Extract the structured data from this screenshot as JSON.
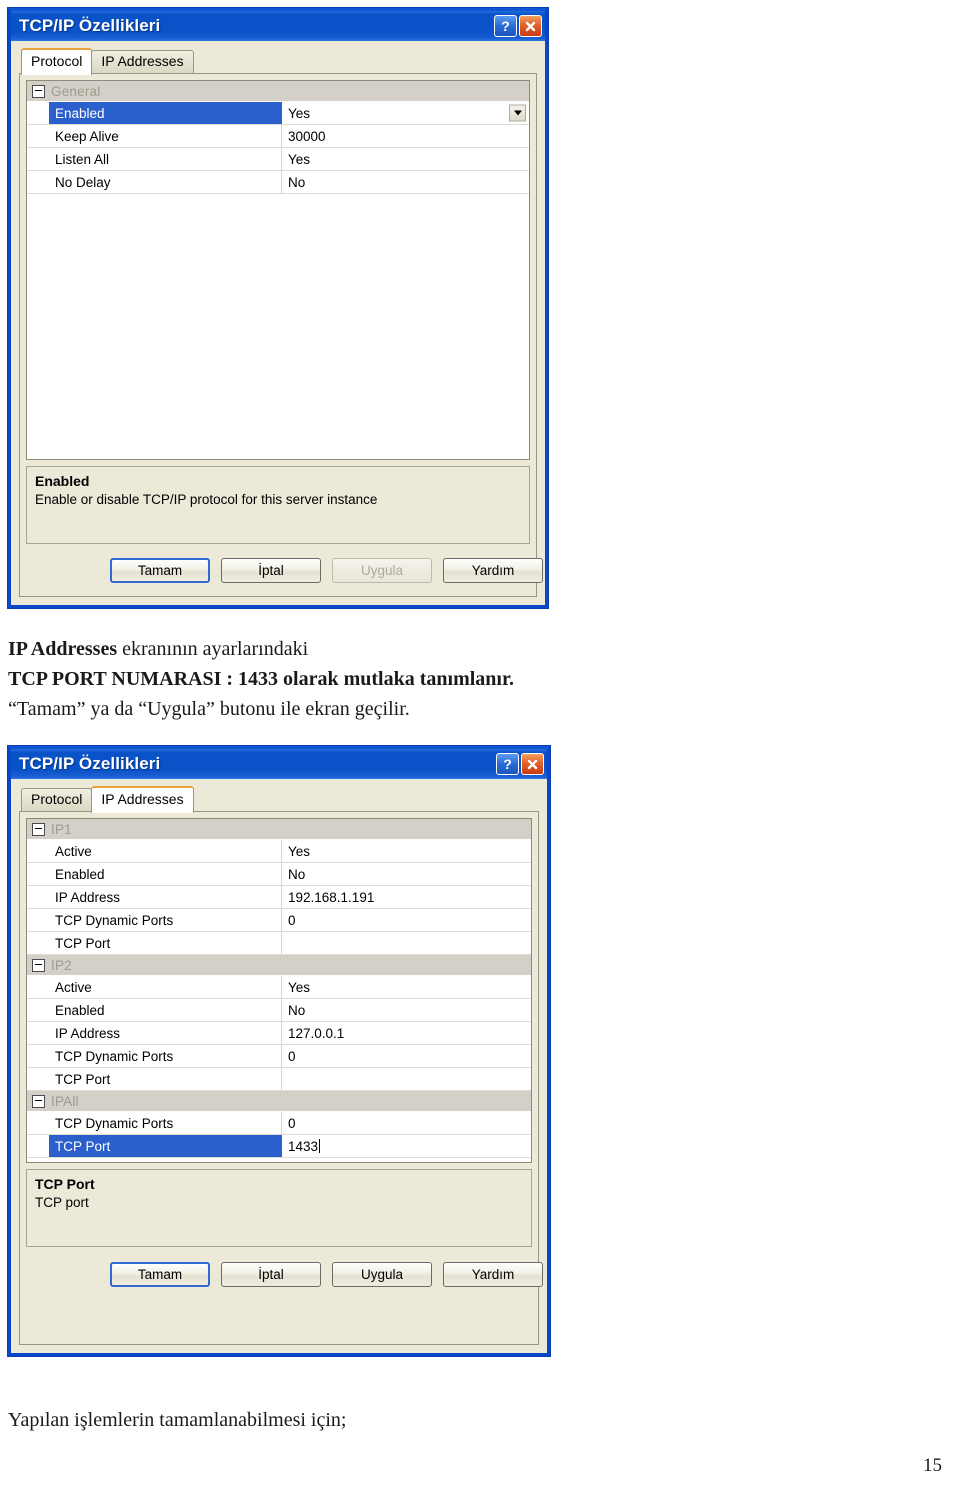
{
  "document": {
    "paragraph_1": {
      "line1_bold": "IP Addresses",
      "line1_rest": " ekranının ayarlarındaki",
      "line2": "TCP PORT NUMARASI : 1433 olarak mutlaka tanımlanır.",
      "line3": "“Tamam” ya da “Uygula” butonu ile ekran geçilir."
    },
    "paragraph_2": "Yapılan işlemlerin tamamlanabilmesi için;",
    "page_number": "15"
  },
  "dialog1": {
    "title": "TCP/IP Özellikleri",
    "help_button": "?",
    "close_button": "✕",
    "tabs": [
      {
        "label": "Protocol",
        "active": true
      },
      {
        "label": "IP Addresses",
        "active": false
      }
    ],
    "grid": {
      "groups": [
        {
          "name": "General",
          "rows": [
            {
              "name": "Enabled",
              "value": "Yes",
              "selected": true,
              "combo": true
            },
            {
              "name": "Keep Alive",
              "value": "30000",
              "selected": false,
              "combo": false
            },
            {
              "name": "Listen All",
              "value": "Yes",
              "selected": false,
              "combo": false
            },
            {
              "name": "No Delay",
              "value": "No",
              "selected": false,
              "combo": false
            }
          ]
        }
      ]
    },
    "description": {
      "title": "Enabled",
      "text": "Enable or disable TCP/IP protocol for this server instance"
    },
    "buttons": [
      {
        "label": "Tamam",
        "default": true,
        "disabled": false
      },
      {
        "label": "İptal",
        "default": false,
        "disabled": false
      },
      {
        "label": "Uygula",
        "default": false,
        "disabled": true
      },
      {
        "label": "Yardım",
        "default": false,
        "disabled": false
      }
    ]
  },
  "dialog2": {
    "title": "TCP/IP Özellikleri",
    "help_button": "?",
    "close_button": "✕",
    "tabs": [
      {
        "label": "Protocol",
        "active": false
      },
      {
        "label": "IP Addresses",
        "active": true
      }
    ],
    "grid": {
      "groups": [
        {
          "name": "IP1",
          "rows": [
            {
              "name": "Active",
              "value": "Yes",
              "selected": false
            },
            {
              "name": "Enabled",
              "value": "No",
              "selected": false
            },
            {
              "name": "IP Address",
              "value": "192.168.1.191",
              "selected": false
            },
            {
              "name": "TCP Dynamic Ports",
              "value": "0",
              "selected": false
            },
            {
              "name": "TCP Port",
              "value": "",
              "selected": false
            }
          ]
        },
        {
          "name": "IP2",
          "rows": [
            {
              "name": "Active",
              "value": "Yes",
              "selected": false
            },
            {
              "name": "Enabled",
              "value": "No",
              "selected": false
            },
            {
              "name": "IP Address",
              "value": "127.0.0.1",
              "selected": false
            },
            {
              "name": "TCP Dynamic Ports",
              "value": "0",
              "selected": false
            },
            {
              "name": "TCP Port",
              "value": "",
              "selected": false
            }
          ]
        },
        {
          "name": "IPAll",
          "rows": [
            {
              "name": "TCP Dynamic Ports",
              "value": "0",
              "selected": false
            },
            {
              "name": "TCP Port",
              "value": "1433",
              "selected": true,
              "caret": true
            }
          ]
        }
      ]
    },
    "description": {
      "title": "TCP Port",
      "text": "TCP port"
    },
    "buttons": [
      {
        "label": "Tamam",
        "default": true,
        "disabled": false
      },
      {
        "label": "İptal",
        "default": false,
        "disabled": false
      },
      {
        "label": "Uygula",
        "default": false,
        "disabled": false
      },
      {
        "label": "Yardım",
        "default": false,
        "disabled": false
      }
    ]
  },
  "colors": {
    "titlebar_blue": "#0a52c8",
    "selection_blue": "#2a5fcc",
    "dialog_face": "#ece9d8",
    "tab_accent_orange": "#e8a33d",
    "close_red": "#e2622c"
  }
}
